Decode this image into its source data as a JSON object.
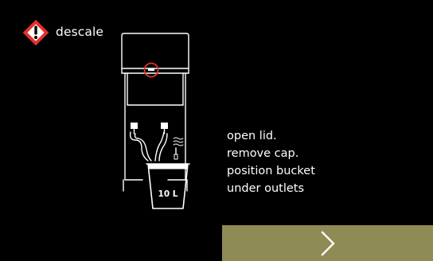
{
  "header": {
    "title": "descale",
    "icon": "warning-exclamation-diamond-icon",
    "icon_color": "#e4312b"
  },
  "illustration": {
    "bucket_label": "10 L",
    "highlight_color": "#e4312b"
  },
  "instructions": [
    "open lid.",
    "remove cap.",
    "position bucket",
    "under outlets"
  ],
  "next_button": {
    "icon": "chevron-right-icon",
    "background": "#8f8b55"
  }
}
